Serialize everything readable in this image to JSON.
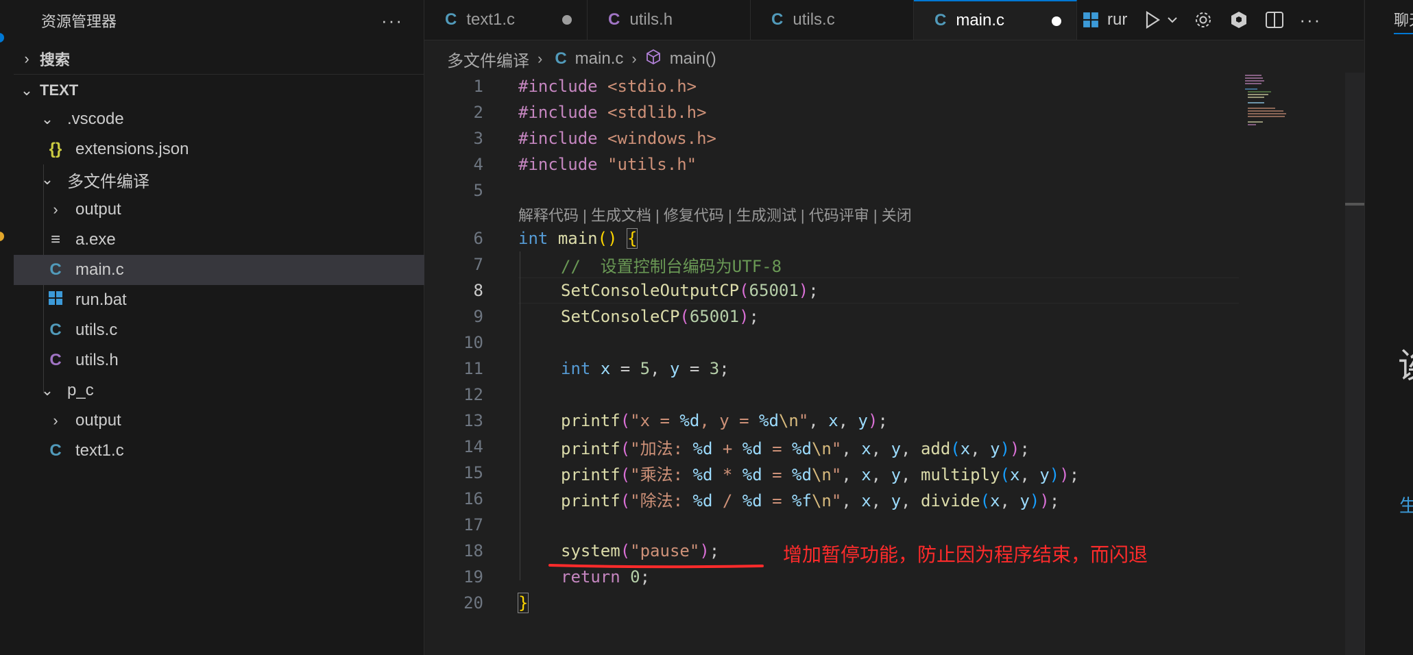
{
  "sidebar": {
    "title": "资源管理器",
    "more": "···",
    "search_section": "搜索",
    "workspace_section": "TEXT",
    "tree": [
      {
        "label": ".vscode",
        "icon": "chevron-down-icon"
      },
      {
        "label": "extensions.json",
        "icon": "json-icon"
      },
      {
        "label": "多文件编译",
        "icon": "chevron-down-icon"
      },
      {
        "label": "output",
        "icon": "chevron-right-icon"
      },
      {
        "label": "a.exe",
        "icon": "binary-file-icon"
      },
      {
        "label": "main.c",
        "icon": "c-file-icon"
      },
      {
        "label": "run.bat",
        "icon": "windows-icon"
      },
      {
        "label": "utils.c",
        "icon": "c-file-icon"
      },
      {
        "label": "utils.h",
        "icon": "h-file-icon"
      },
      {
        "label": "p_c",
        "icon": "chevron-down-icon"
      },
      {
        "label": "output",
        "icon": "chevron-right-icon"
      },
      {
        "label": "text1.c",
        "icon": "c-file-icon"
      }
    ]
  },
  "tabs": [
    {
      "label": "text1.c",
      "modified": true
    },
    {
      "label": "utils.h",
      "modified": false
    },
    {
      "label": "utils.c",
      "modified": false
    },
    {
      "label": "main.c",
      "modified": true
    }
  ],
  "tab_actions": {
    "run_label": "rur"
  },
  "breadcrumb": {
    "folder": "多文件编译",
    "file": "main.c",
    "symbol": "main()"
  },
  "editor": {
    "codelens": "解释代码 | 生成文档 | 修复代码 | 生成测试 | 代码评审 | 关闭",
    "line_numbers": [
      "1",
      "2",
      "3",
      "4",
      "5",
      "6",
      "7",
      "8",
      "9",
      "10",
      "11",
      "12",
      "13",
      "14",
      "15",
      "16",
      "17",
      "18",
      "19",
      "20"
    ],
    "lines": {
      "l1_a": "#include",
      "l1_b": "<stdio.h>",
      "l2_a": "#include",
      "l2_b": "<stdlib.h>",
      "l3_a": "#include",
      "l3_b": "<windows.h>",
      "l4_a": "#include",
      "l4_b": "\"utils.h\"",
      "l7": "//  设置控制台编码为UTF-8",
      "l8_fn": "SetConsoleOutputCP",
      "l8_num": "65001",
      "l9_fn": "SetConsoleCP",
      "l9_num": "65001",
      "l18_fn": "system",
      "l18_str": "\"pause\"",
      "l19_kw": "return",
      "l19_num": "0"
    },
    "annotation": "增加暂停功能，防止因为程序结束，而闪退"
  },
  "colors": {
    "accent": "#0078d4",
    "annotation": "#ff2b2b"
  },
  "right_panel": {
    "label_top": "聊天",
    "glyph_mid": "诶",
    "glyph_low": "生"
  }
}
